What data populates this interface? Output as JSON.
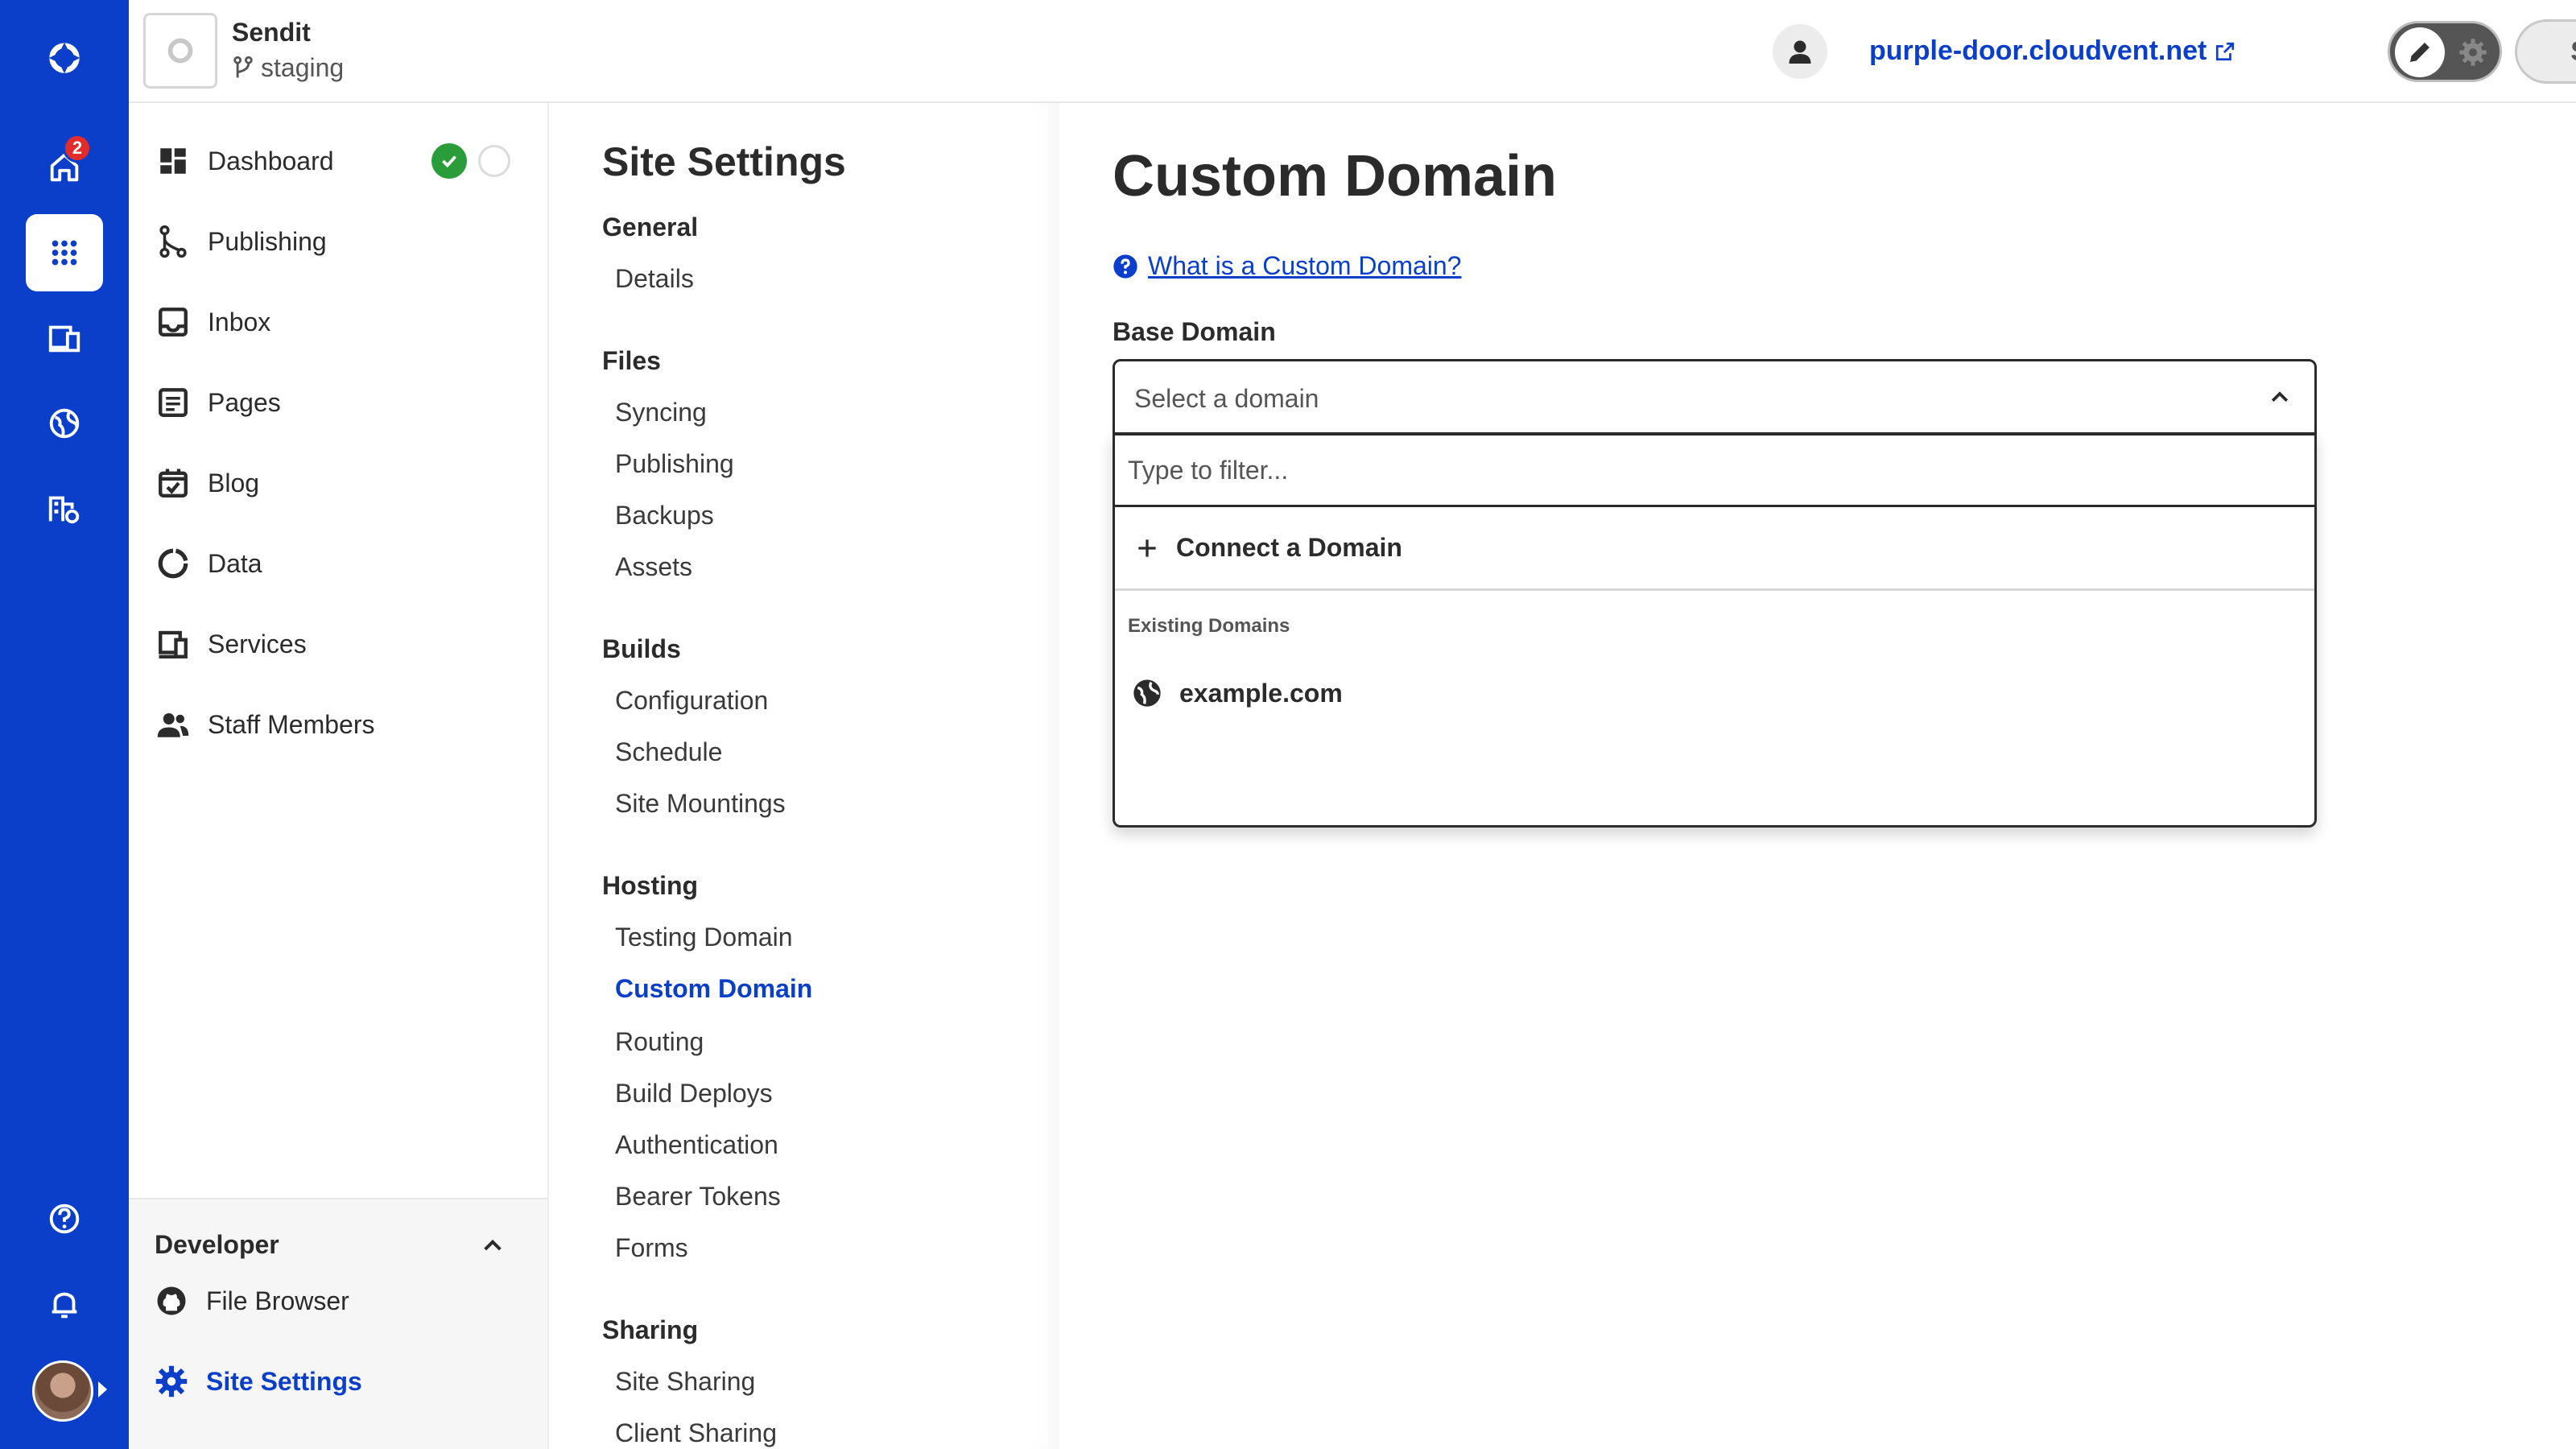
{
  "rail": {
    "items": [
      {
        "name": "logo-icon"
      },
      {
        "name": "home-icon",
        "badge": "2"
      },
      {
        "name": "apps-grid-icon"
      },
      {
        "name": "devices-icon"
      },
      {
        "name": "globe-icon"
      },
      {
        "name": "building-settings-icon"
      },
      {
        "name": "help-icon"
      },
      {
        "name": "bell-icon"
      }
    ]
  },
  "header": {
    "site_name": "Sendit",
    "branch": "staging",
    "site_url": "purple-door.cloudvent.net",
    "save_label": "Save"
  },
  "sidebar": {
    "items": [
      {
        "label": "Dashboard"
      },
      {
        "label": "Publishing"
      },
      {
        "label": "Inbox"
      },
      {
        "label": "Pages"
      },
      {
        "label": "Blog"
      },
      {
        "label": "Data"
      },
      {
        "label": "Services"
      },
      {
        "label": "Staff Members"
      }
    ],
    "developer": {
      "title": "Developer",
      "items": [
        {
          "label": "File Browser"
        },
        {
          "label": "Site Settings"
        }
      ]
    }
  },
  "settings_nav": {
    "title": "Site Settings",
    "groups": [
      {
        "label": "General",
        "items": [
          "Details"
        ]
      },
      {
        "label": "Files",
        "items": [
          "Syncing",
          "Publishing",
          "Backups",
          "Assets"
        ]
      },
      {
        "label": "Builds",
        "items": [
          "Configuration",
          "Schedule",
          "Site Mountings"
        ]
      },
      {
        "label": "Hosting",
        "items": [
          "Testing Domain",
          "Custom Domain",
          "Routing",
          "Build Deploys",
          "Authentication",
          "Bearer Tokens",
          "Forms"
        ]
      },
      {
        "label": "Sharing",
        "items": [
          "Site Sharing",
          "Client Sharing"
        ]
      }
    ],
    "active": "Custom Domain"
  },
  "main": {
    "title": "Custom Domain",
    "help_link": "What is a Custom Domain?",
    "field_label": "Base Domain",
    "select_placeholder": "Select a domain",
    "filter_placeholder": "Type to filter...",
    "connect_label": "Connect a Domain",
    "existing_header": "Existing Domains",
    "domains": [
      "example.com"
    ]
  },
  "colors": {
    "brand": "#0b3fc9",
    "success": "#2a9d3a",
    "badge": "#e22b2b"
  }
}
